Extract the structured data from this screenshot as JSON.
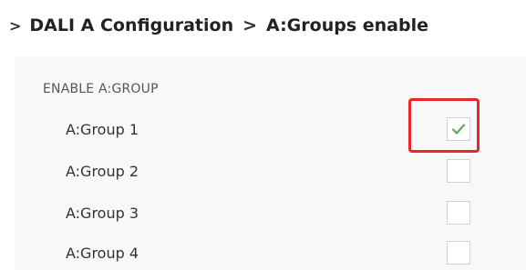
{
  "breadcrumb": {
    "leading_separator": ">",
    "items": [
      {
        "label": "DALI A Configuration"
      },
      {
        "label": "A:Groups enable"
      }
    ],
    "separator": ">"
  },
  "section": {
    "heading": "ENABLE A:GROUP",
    "groups": [
      {
        "label": "A:Group 1",
        "checked": true
      },
      {
        "label": "A:Group 2",
        "checked": false
      },
      {
        "label": "A:Group 3",
        "checked": false
      },
      {
        "label": "A:Group 4",
        "checked": false
      }
    ]
  },
  "colors": {
    "checkmark": "#5fa85f",
    "highlight_box": "#e8272b",
    "content_background": "#f8f8f8"
  },
  "icons": {
    "check": "checkmark-icon"
  }
}
